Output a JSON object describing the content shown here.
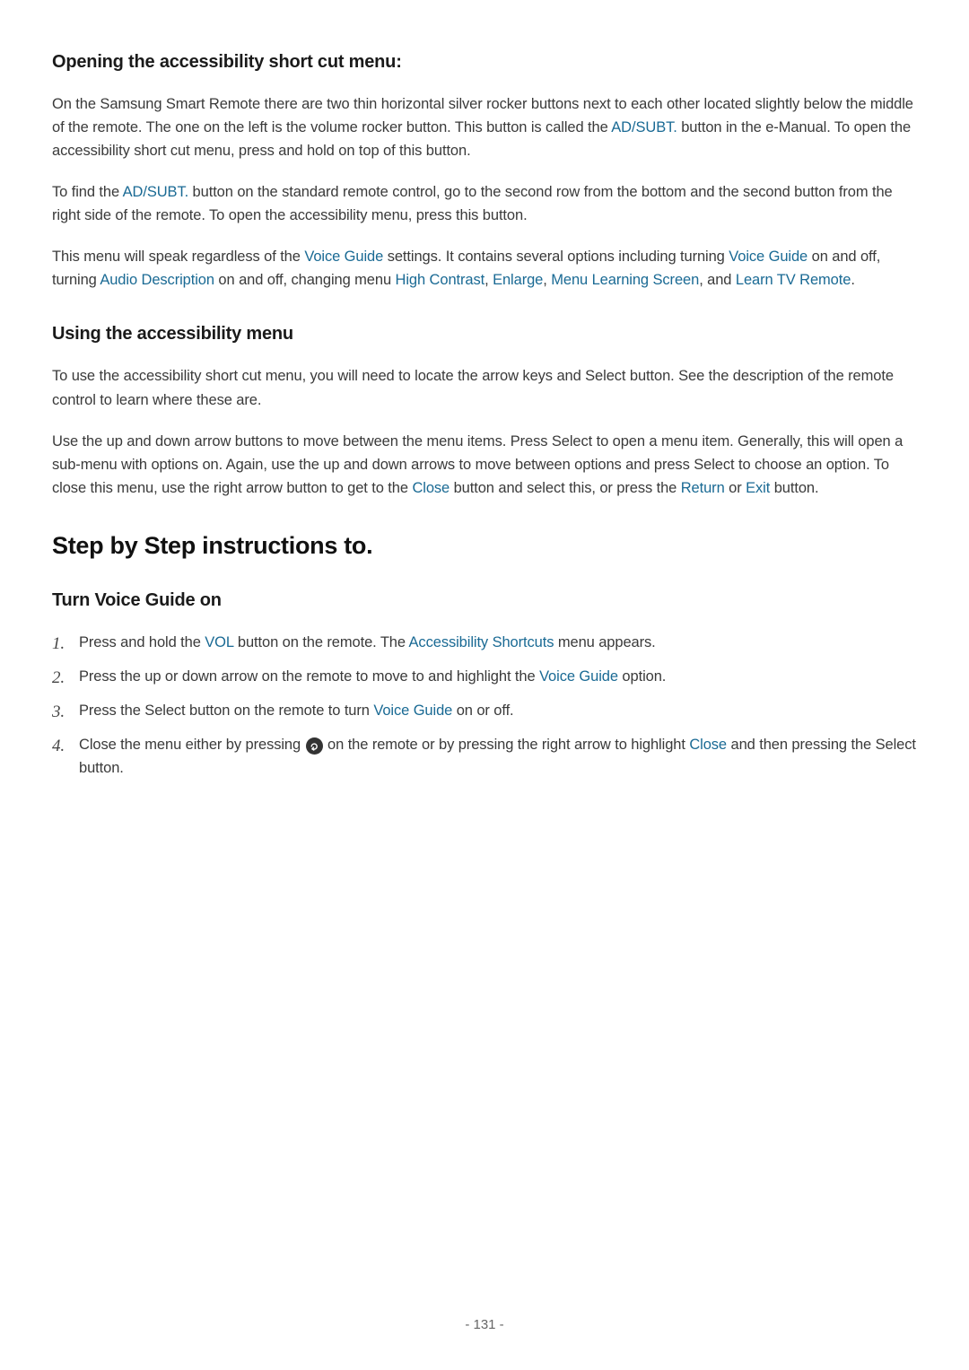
{
  "sec1": {
    "heading": "Opening the accessibility short cut menu:",
    "p1": {
      "t1": "On the Samsung Smart Remote there are two thin horizontal silver rocker buttons next to each other located slightly below the middle of the remote. The one on the left is the volume rocker button. This button is called the ",
      "l1": "AD/SUBT.",
      "t2": " button in the e-Manual. To open the accessibility short cut menu, press and hold on top of this button."
    },
    "p2": {
      "t1": "To find the ",
      "l1": "AD/SUBT.",
      "t2": " button on the standard remote control, go to the second row from the bottom and the second button from the right side of the remote. To open the accessibility menu, press this button."
    },
    "p3": {
      "t1": "This menu will speak regardless of the ",
      "l1": "Voice Guide",
      "t2": " settings. It contains several options including turning ",
      "l2": "Voice Guide",
      "t3": " on and off, turning ",
      "l3": "Audio Description",
      "t4": " on and off, changing menu ",
      "l4": "High Contrast",
      "t5": ", ",
      "l5": "Enlarge",
      "t6": ", ",
      "l6": "Menu Learning Screen",
      "t7": ", and ",
      "l7": "Learn TV Remote",
      "t8": "."
    }
  },
  "sec2": {
    "heading": "Using the accessibility menu",
    "p1": "To use the accessibility short cut menu, you will need to locate the arrow keys and Select button. See the description of the remote control to learn where these are.",
    "p2": {
      "t1": "Use the up and down arrow buttons to move between the menu items. Press Select to open a menu item. Generally, this will open a sub-menu with options on. Again, use the up and down arrows to move between options and press Select to choose an option. To close this menu, use the right arrow button to get to the ",
      "l1": "Close",
      "t2": " button and select this, or press the ",
      "l2": "Return",
      "t3": " or ",
      "l3": "Exit",
      "t4": " button."
    }
  },
  "sec3": {
    "heading": "Step by Step instructions to.",
    "sub": "Turn Voice Guide on",
    "steps": {
      "s1": {
        "num": "1.",
        "t1": "Press and hold the ",
        "l1": "VOL",
        "t2": " button on the remote. The ",
        "l2": "Accessibility Shortcuts",
        "t3": " menu appears."
      },
      "s2": {
        "num": "2.",
        "t1": "Press the up or down arrow on the remote to move to and highlight the ",
        "l1": "Voice Guide",
        "t2": " option."
      },
      "s3": {
        "num": "3.",
        "t1": "Press the Select button on the remote to turn ",
        "l1": "Voice Guide",
        "t2": " on or off."
      },
      "s4": {
        "num": "4.",
        "t1": "Close the menu either by pressing ",
        "t2": " on the remote or by pressing the right arrow to highlight ",
        "l1": "Close",
        "t3": " and then pressing the Select button."
      }
    }
  },
  "pageNumber": "- 131 -"
}
